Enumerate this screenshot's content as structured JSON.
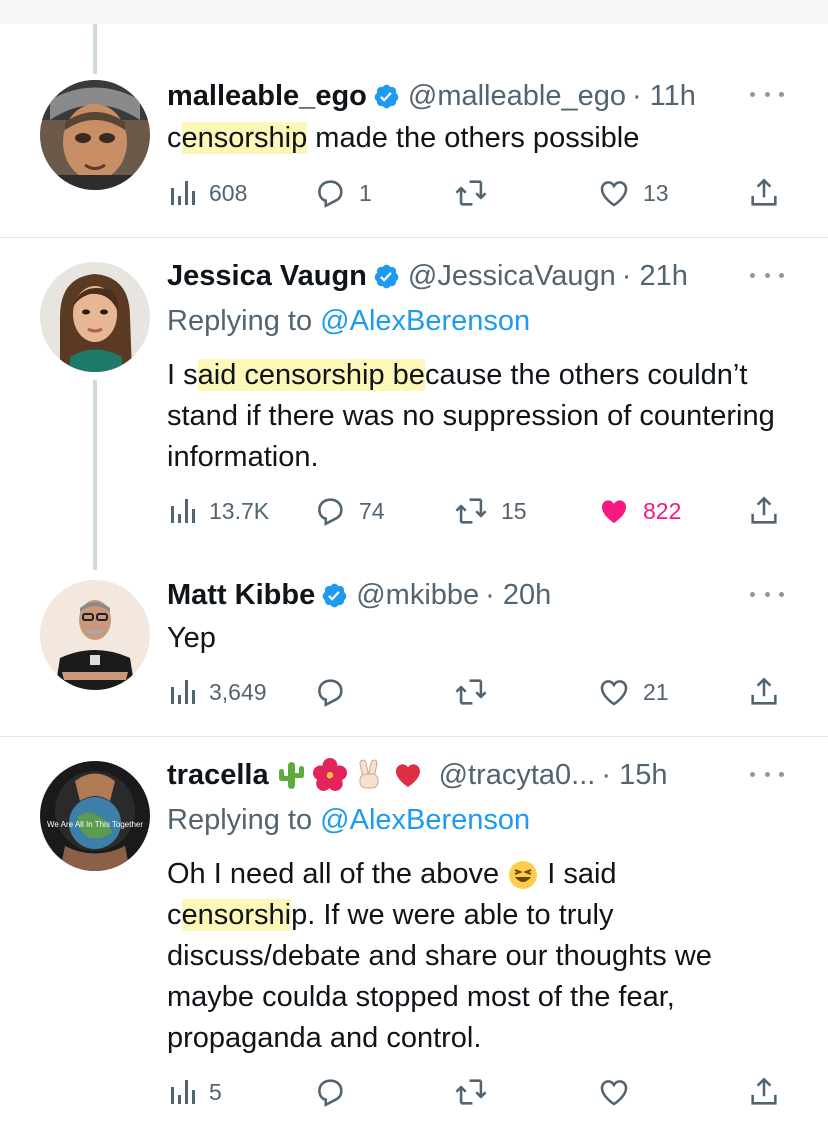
{
  "tweets": [
    {
      "name": "malleable_ego",
      "handle": "@malleable_ego",
      "time": "· 11h",
      "body_pre": "c",
      "body_hl": "ensorship",
      "body_post": " made the others possible",
      "stats": {
        "views": "608",
        "replies": "1",
        "retweets": "",
        "likes": "13"
      }
    },
    {
      "name": "Jessica Vaugn",
      "handle": "@JessicaVaugn",
      "time": "· 21h",
      "replying_prefix": "Replying to ",
      "replying_to": "@AlexBerenson",
      "body_pre": "I s",
      "body_hl": "aid censorship be",
      "body_post": "cause the others couldn’t stand if there was no suppression of countering information.",
      "stats": {
        "views": "13.7K",
        "replies": "74",
        "retweets": "15",
        "likes": "822"
      }
    },
    {
      "name": "Matt Kibbe",
      "handle": "@mkibbe",
      "time": "· 20h",
      "body": "Yep",
      "stats": {
        "views": "3,649",
        "replies": "",
        "retweets": "",
        "likes": "21"
      }
    },
    {
      "name": "tracella",
      "handle": "@tracyta0...",
      "time": "· 15h",
      "replying_prefix": "Replying to ",
      "replying_to": "@AlexBerenson",
      "body_line1_a": "Oh I need all of the above ",
      "body_line1_b": " I said",
      "body_line2_pre": "c",
      "body_line2_hl": "ensorshi",
      "body_line2_post": "p. If we were able to truly discuss/debate and share our thoughts we maybe coulda stopped most of the fear, propaganda and control.",
      "avatar_caption": "We Are All In This Together",
      "stats": {
        "views": "5",
        "replies": "",
        "retweets": "",
        "likes": ""
      }
    }
  ],
  "colors": {
    "verified": "#1d9bf0",
    "link": "#1d9bf0",
    "like_active": "#f91880",
    "muted": "#536471",
    "highlight": "#fdf8b8"
  },
  "icons": [
    "views-icon",
    "reply-icon",
    "retweet-icon",
    "like-icon",
    "share-icon",
    "verified-badge-icon",
    "more-icon"
  ]
}
